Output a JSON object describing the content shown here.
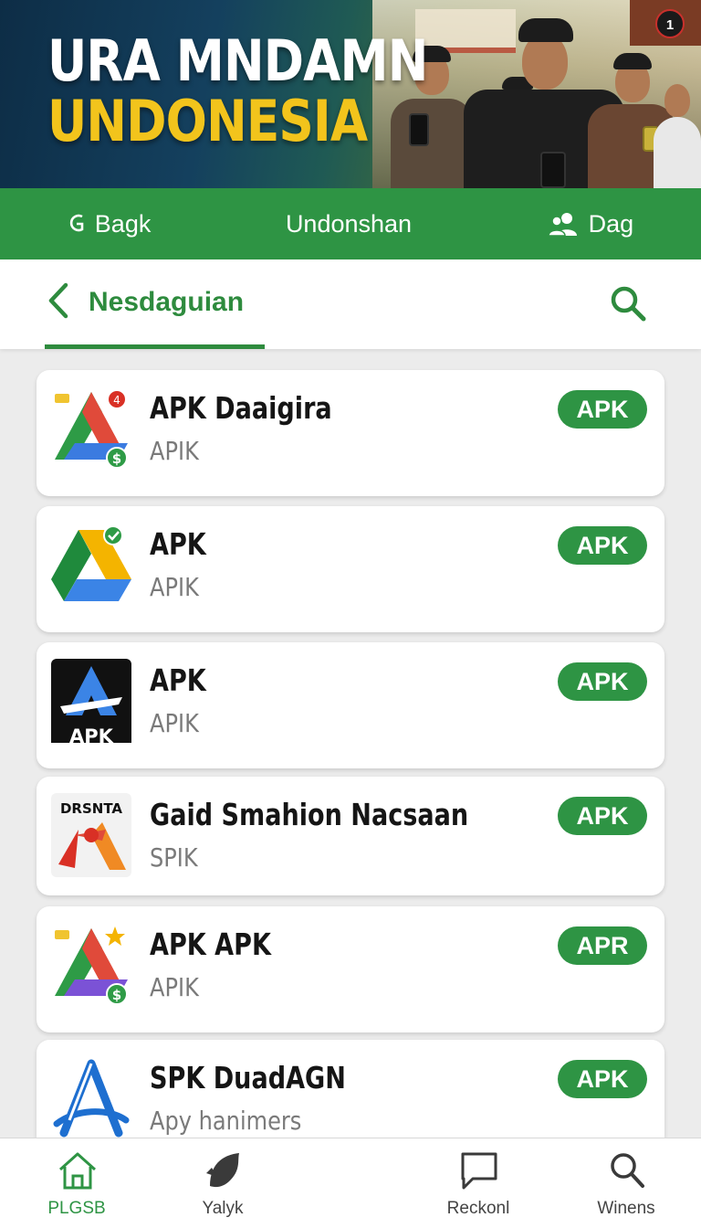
{
  "hero": {
    "title_line1": "URA MNDAMN",
    "title_line2": "UNDONESIA",
    "badge": "1"
  },
  "greenbar": {
    "items": [
      {
        "label": "Bagk",
        "icon": "g-icon"
      },
      {
        "label": "Undonshan",
        "icon": ""
      },
      {
        "label": "Dag",
        "icon": "users-icon"
      }
    ]
  },
  "subheader": {
    "title": "Nesdaguian",
    "back_icon": "chevron-left-icon",
    "search_icon": "search-icon"
  },
  "apps": [
    {
      "name": "APK Daaigira",
      "sub": "APIK",
      "badge": "APK",
      "icon": "drive-money-icon"
    },
    {
      "name": "APK",
      "sub": "APIK",
      "badge": "APK",
      "icon": "drive-check-icon"
    },
    {
      "name": "APK",
      "sub": "APIK",
      "badge": "APK",
      "icon": "apk-dark-icon",
      "icon_text": "APK"
    },
    {
      "name": "Gaid Smahion Nacsaan",
      "sub": "SPIK",
      "badge": "APK",
      "icon": "drsnta-icon",
      "icon_text": "DRSNTA"
    },
    {
      "name": "APK APK",
      "sub": "APIK",
      "badge": "APR",
      "icon": "drive-purple-icon"
    },
    {
      "name": "SPK DuadAGN",
      "sub": "Apy hanimers",
      "badge": "APK",
      "icon": "blue-a-icon"
    }
  ],
  "bottomnav": {
    "items": [
      {
        "label": "PLGSB",
        "icon": "home-icon",
        "active": true
      },
      {
        "label": "Yalyk",
        "icon": "leaf-icon"
      },
      {
        "label": "Reckonl",
        "icon": "chat-icon"
      },
      {
        "label": "Winens",
        "icon": "search-icon"
      }
    ]
  },
  "colors": {
    "primary_green": "#2e9444",
    "title_yellow": "#f2c41c",
    "background": "#ececec"
  }
}
